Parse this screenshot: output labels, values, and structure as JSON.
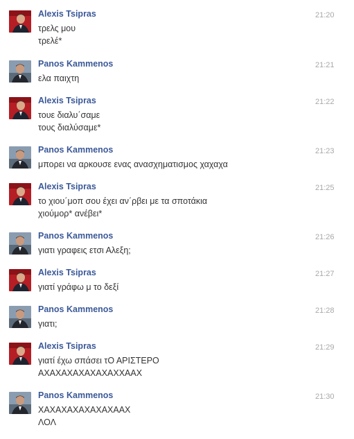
{
  "messages": [
    {
      "sender": "Alexis Tsipras",
      "avatar": "tsipras",
      "time": "21:20",
      "lines": [
        "τρελς μου",
        "τρελέ*"
      ]
    },
    {
      "sender": "Panos Kammenos",
      "avatar": "kammenos",
      "time": "21:21",
      "lines": [
        "ελα παιχτη"
      ]
    },
    {
      "sender": "Alexis Tsipras",
      "avatar": "tsipras",
      "time": "21:22",
      "lines": [
        "τουε διαλυ΄σαμε",
        "τους διαλύσαμε*"
      ]
    },
    {
      "sender": "Panos Kammenos",
      "avatar": "kammenos",
      "time": "21:23",
      "lines": [
        "μπορει να αρκουσε ενας ανασχηματισμος χαχαχα"
      ]
    },
    {
      "sender": "Alexis Tsipras",
      "avatar": "tsipras",
      "time": "21:25",
      "lines": [
        "το χιου΄μοπ σου έχει αν΄ρβει με τα σποτάκια",
        "χιούμορ* ανέβει*"
      ]
    },
    {
      "sender": "Panos Kammenos",
      "avatar": "kammenos",
      "time": "21:26",
      "lines": [
        "γιατι γραφεις ετσι Αλεξη;"
      ]
    },
    {
      "sender": "Alexis Tsipras",
      "avatar": "tsipras",
      "time": "21:27",
      "lines": [
        "γιατί γράφω μ το δεξί"
      ]
    },
    {
      "sender": "Panos Kammenos",
      "avatar": "kammenos",
      "time": "21:28",
      "lines": [
        "γιατι;"
      ]
    },
    {
      "sender": "Alexis Tsipras",
      "avatar": "tsipras",
      "time": "21:29",
      "lines": [
        "γιατί έχω σπάσει τΟ ΑΡΙΣΤΕΡΟ",
        "ΑΧΑΧΑΧΑΧΑΧΑΧΑΧΧΑΑΧ"
      ]
    },
    {
      "sender": "Panos Kammenos",
      "avatar": "kammenos",
      "time": "21:30",
      "lines": [
        "ΧΑΧΑΧΑΧΑΧΑΧΑΧΑΑΧ",
        "ΛΟΛ"
      ]
    }
  ],
  "colors": {
    "name": "#3b5998",
    "text": "#333333",
    "time": "#a8a8a8"
  }
}
